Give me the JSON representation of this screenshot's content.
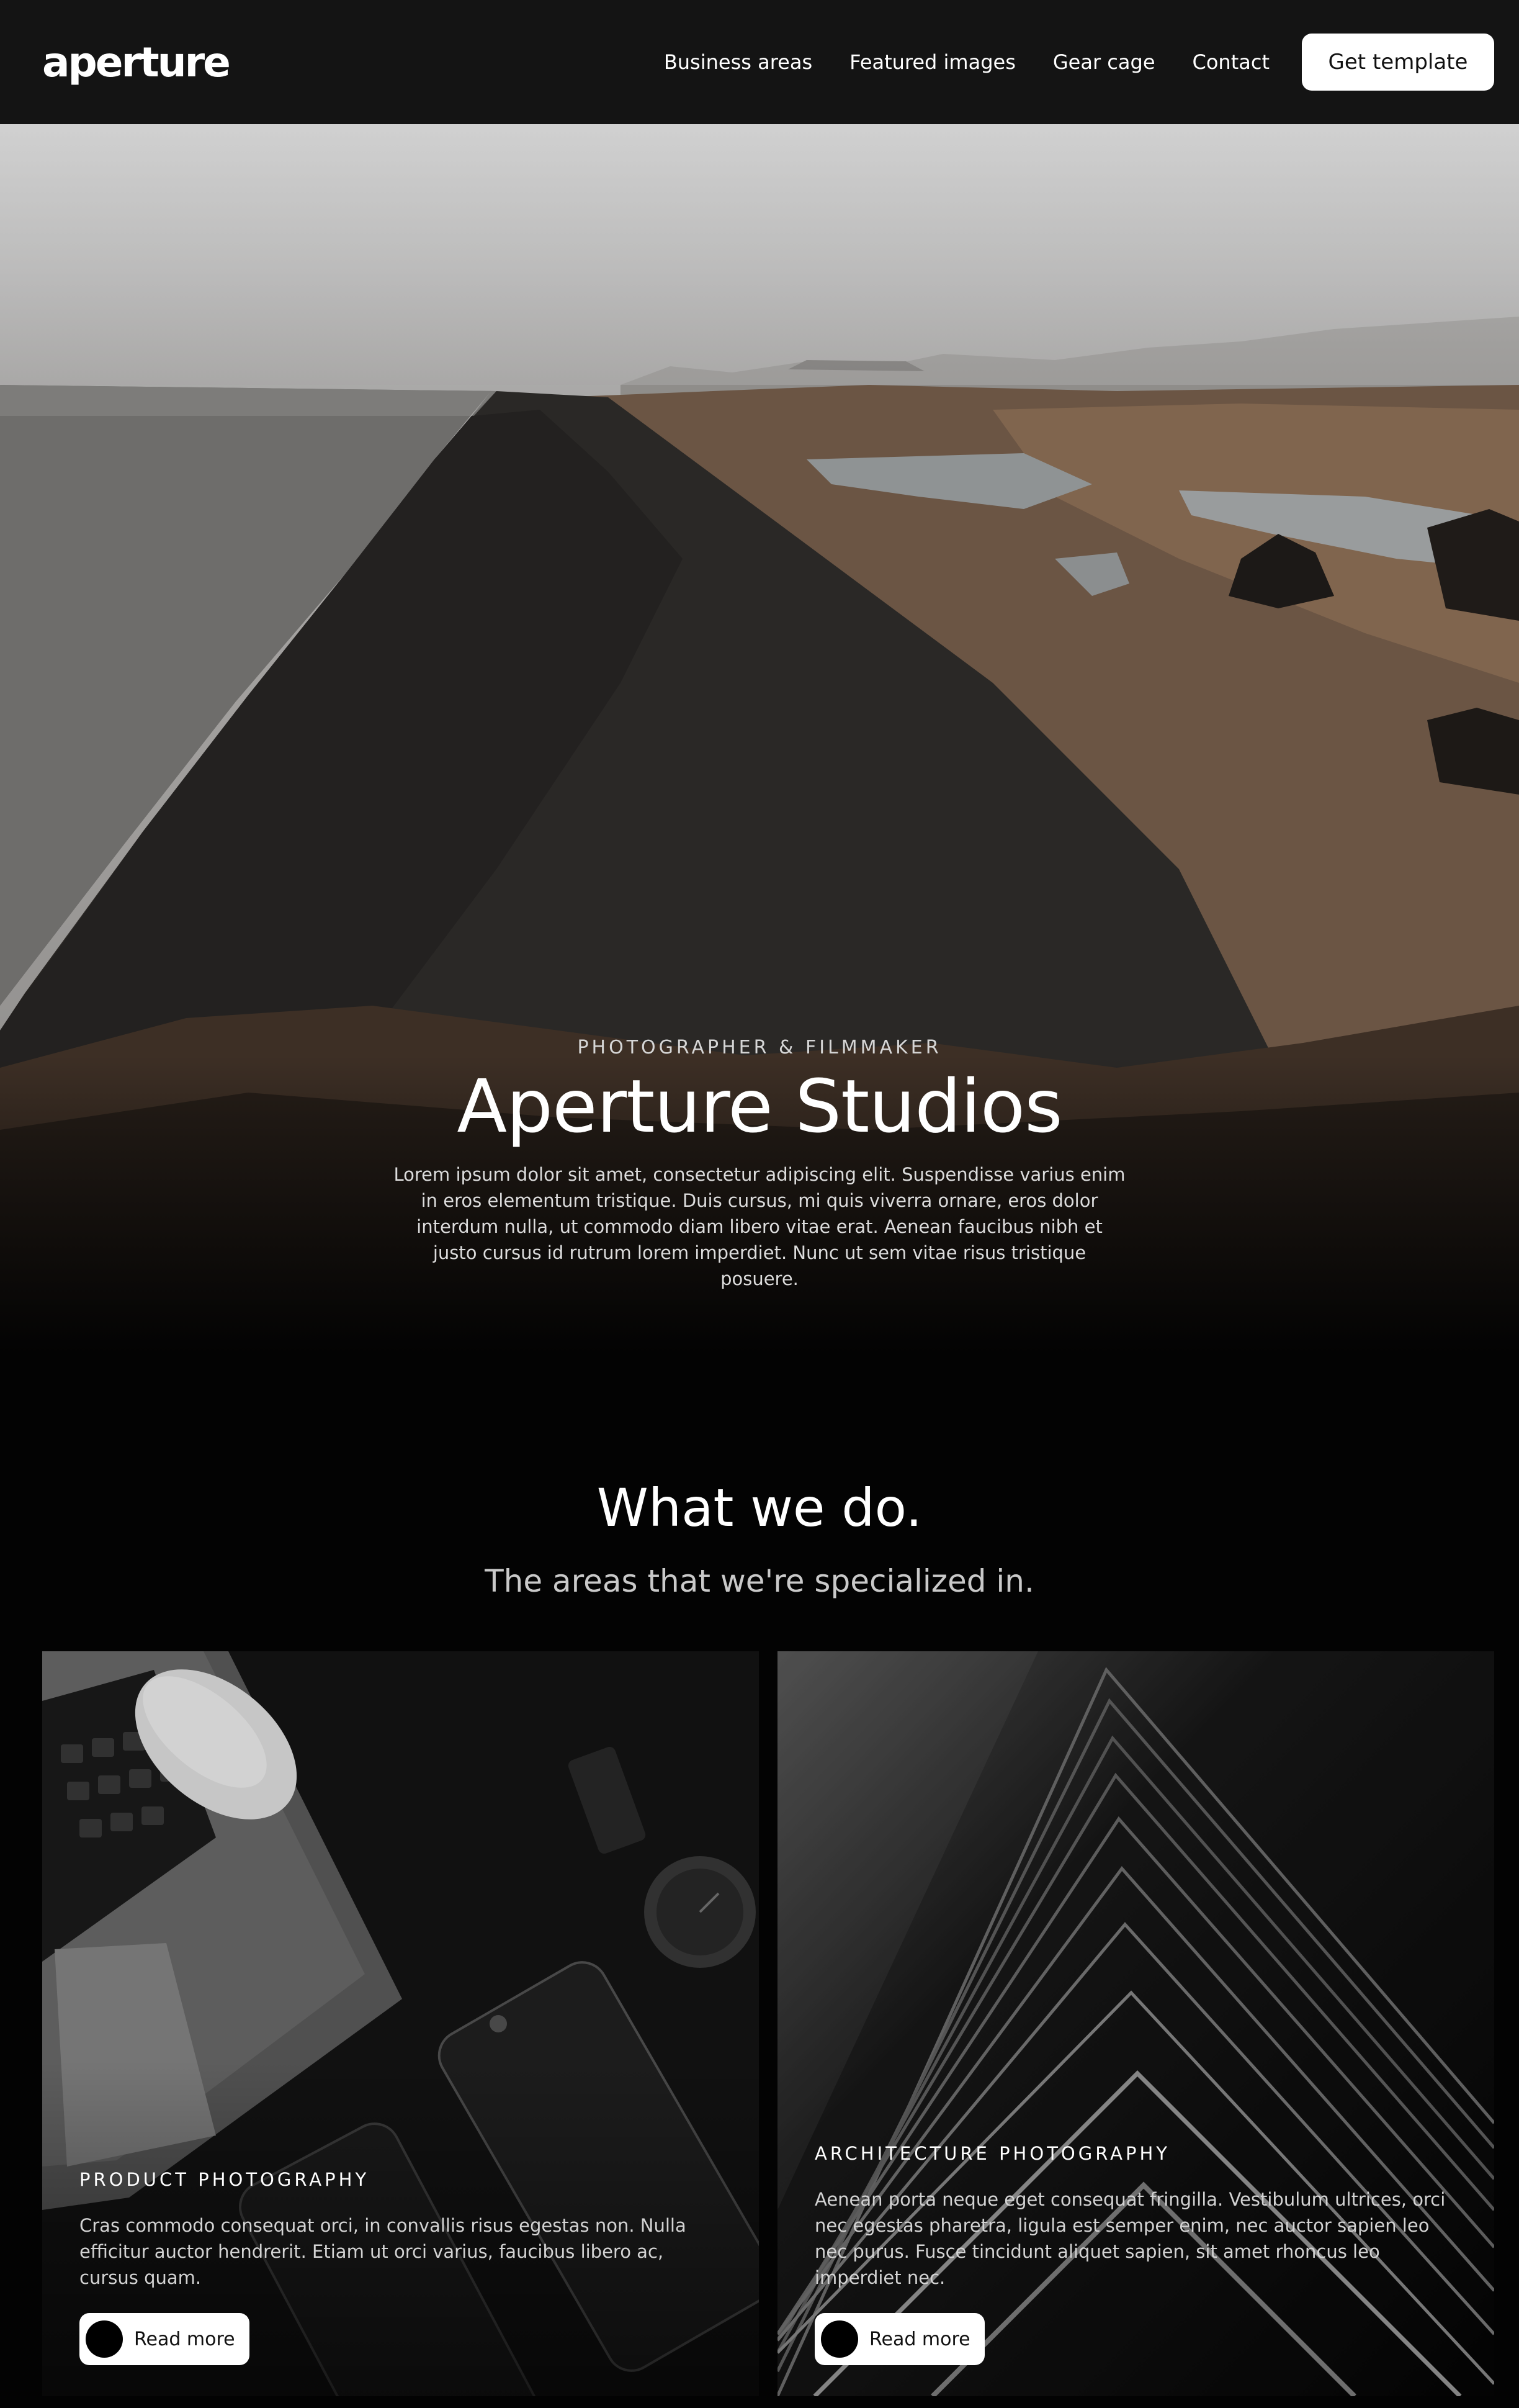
{
  "nav": {
    "logo": "aperture",
    "links": [
      "Business areas",
      "Featured images",
      "Gear cage",
      "Contact"
    ],
    "cta_label": "Get template"
  },
  "hero": {
    "eyebrow": "PHOTOGRAPHER & FILMMAKER",
    "title": "Aperture Studios",
    "description": "Lorem ipsum dolor sit amet, consectetur adipiscing elit. Suspendisse varius enim in eros elementum tristique. Duis cursus, mi quis viverra ornare, eros dolor interdum nulla, ut commodo diam libero vitae erat. Aenean faucibus nibh et justo cursus id rutrum lorem imperdiet. Nunc ut sem vitae risus tristique posuere."
  },
  "section": {
    "title": "What we do.",
    "subtitle": "The areas that we're specialized in."
  },
  "cards": [
    {
      "eyebrow": "PRODUCT PHOTOGRAPHY",
      "description": "Cras commodo consequat orci, in convallis risus egestas non. Nulla efficitur auctor hendrerit. Etiam ut orci varius, faucibus libero ac, cursus quam.",
      "button_label": "Read more"
    },
    {
      "eyebrow": "ARCHITECTURE PHOTOGRAPHY",
      "description": "Aenean porta neque eget consequat fringilla. Vestibulum ultrices, orci nec egestas pharetra, ligula est semper enim, nec auctor sapien leo nec purus. Fusce tincidunt aliquet sapien, sit amet rhoncus leo imperdiet nec.",
      "button_label": "Read more"
    }
  ]
}
